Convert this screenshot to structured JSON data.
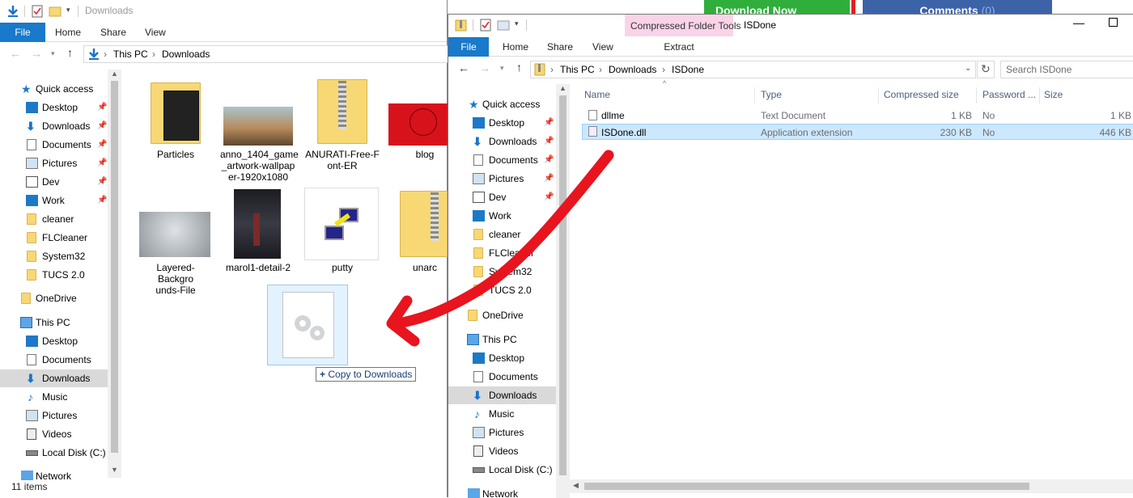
{
  "background": {
    "download_button": "Download Now",
    "comments_button": "Comments",
    "comments_count": "(0)"
  },
  "left_window": {
    "title": "Downloads",
    "tabs": [
      "File",
      "Home",
      "Share",
      "View"
    ],
    "breadcrumb": [
      "This PC",
      "Downloads"
    ],
    "nav": {
      "quick_access": "Quick access",
      "quick_items": [
        {
          "label": "Desktop",
          "icon": "desktop-icon",
          "pinned": true
        },
        {
          "label": "Downloads",
          "icon": "downloads-icon",
          "pinned": true
        },
        {
          "label": "Documents",
          "icon": "documents-icon",
          "pinned": true
        },
        {
          "label": "Pictures",
          "icon": "pictures-icon",
          "pinned": true
        },
        {
          "label": "Dev",
          "icon": "folder-icon",
          "pinned": true
        },
        {
          "label": "Work",
          "icon": "folder-icon",
          "pinned": true
        },
        {
          "label": "cleaner",
          "icon": "folder-icon",
          "pinned": false
        },
        {
          "label": "FLCleaner",
          "icon": "folder-icon",
          "pinned": false
        },
        {
          "label": "System32",
          "icon": "folder-icon",
          "pinned": false
        },
        {
          "label": "TUCS 2.0",
          "icon": "folder-icon",
          "pinned": false
        }
      ],
      "onedrive": "OneDrive",
      "this_pc": "This PC",
      "pc_items": [
        "Desktop",
        "Documents",
        "Downloads",
        "Music",
        "Pictures",
        "Videos",
        "Local Disk (C:)"
      ],
      "network": "Network"
    },
    "tiles": [
      {
        "label": "Particles",
        "kind": "folder-dark"
      },
      {
        "label": "anno_1404_game_artwork-wallpaper-1920x1080",
        "kind": "image"
      },
      {
        "label": "ANURATI-Free-Font-ER",
        "kind": "zip"
      },
      {
        "label": "blog",
        "kind": "image-red"
      },
      {
        "label": "Layered-Backgrounds-File",
        "kind": "image-gray"
      },
      {
        "label": "marol1-detail-2",
        "kind": "image-dark"
      },
      {
        "label": "putty",
        "kind": "putty"
      },
      {
        "label": "unarc",
        "kind": "zip"
      }
    ],
    "tile_lines": {
      "t1": [
        "anno_1404_game",
        "_artwork-wallpap",
        "er-1920x1080"
      ],
      "t2": [
        "ANURATI-Free-F",
        "ont-ER"
      ],
      "t4": [
        "Layered-Backgro",
        "unds-File"
      ]
    },
    "drag_tooltip": "Copy to Downloads",
    "status": "11 items"
  },
  "right_window": {
    "title": "ISDone",
    "tabs": [
      "File",
      "Home",
      "Share",
      "View"
    ],
    "contextual_group": "Compressed Folder Tools",
    "contextual_tab": "Extract",
    "breadcrumb": [
      "This PC",
      "Downloads",
      "ISDone"
    ],
    "search_placeholder": "Search ISDone",
    "columns": [
      "Name",
      "Type",
      "Compressed size",
      "Password ...",
      "Size"
    ],
    "files": [
      {
        "name": "dllme",
        "type": "Text Document",
        "compressed": "1 KB",
        "password": "No",
        "size": "1 KB",
        "selected": false
      },
      {
        "name": "ISDone.dll",
        "type": "Application extension",
        "compressed": "230 KB",
        "password": "No",
        "size": "446 KB",
        "selected": true
      }
    ],
    "nav": {
      "quick_access": "Quick access",
      "quick_items": [
        "Desktop",
        "Downloads",
        "Documents",
        "Pictures",
        "Dev",
        "Work",
        "cleaner",
        "FLCleaner",
        "System32",
        "TUCS 2.0"
      ],
      "onedrive": "OneDrive",
      "this_pc": "This PC",
      "pc_items": [
        "Desktop",
        "Documents",
        "Downloads",
        "Music",
        "Pictures",
        "Videos",
        "Local Disk (C:)"
      ],
      "network": "Network"
    }
  },
  "colors": {
    "accent": "#1979ca",
    "selection": "#cce8ff",
    "contextual": "#f9d4e8",
    "annotation": "#e8141e"
  }
}
